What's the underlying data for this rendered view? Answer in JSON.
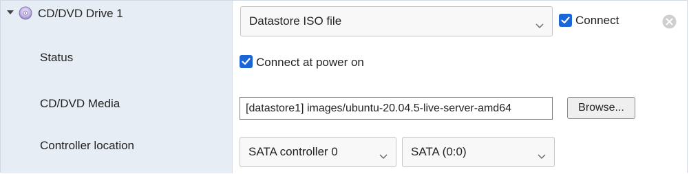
{
  "device": {
    "title": "CD/DVD Drive 1",
    "source_select": {
      "value": "Datastore ISO file"
    },
    "connect_checkbox": {
      "label": "Connect",
      "checked": true
    }
  },
  "status": {
    "label": "Status",
    "power_on_checkbox": {
      "label": "Connect at power on",
      "checked": true
    }
  },
  "media": {
    "label": "CD/DVD Media",
    "path_value": "[datastore1] images/ubuntu-20.04.5-live-server-amd64",
    "browse_label": "Browse..."
  },
  "controller": {
    "label": "Controller location",
    "controller_select": {
      "value": "SATA controller 0"
    },
    "node_select": {
      "value": "SATA (0:0)"
    }
  },
  "colors": {
    "label_bg": "#e7edf5",
    "checkbox_accent": "#1a66d6"
  }
}
